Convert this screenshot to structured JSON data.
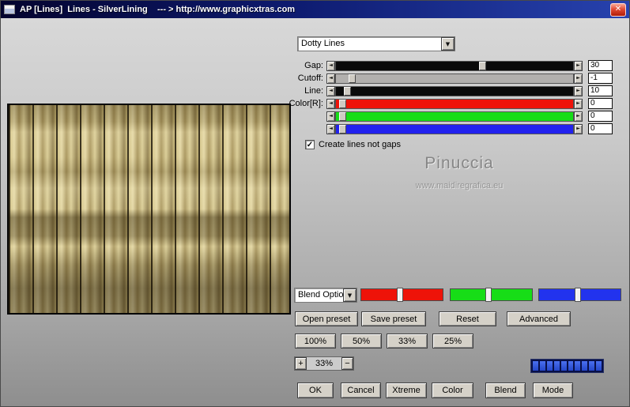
{
  "window": {
    "title": "AP [Lines]  Lines - SilverLining    --- > http://www.graphicxtras.com",
    "close_glyph": "✕"
  },
  "icons": {
    "left": "◄",
    "right": "►",
    "down": "▼",
    "check": "✓"
  },
  "preset": {
    "value": "Dotty Lines"
  },
  "sliders": [
    {
      "label": "Gap:",
      "value": "30",
      "track": "#0a0a0a",
      "thumb": 0.61
    },
    {
      "label": "Cutoff:",
      "value": "-1",
      "track": "#b2b0ae",
      "thumb": 0.06
    },
    {
      "label": "Line:",
      "value": "10",
      "track": "#0a0a0a",
      "thumb": 0.04
    },
    {
      "label": "Color[R]:",
      "value": "0",
      "track": "#ee1309",
      "thumb": 0.02
    },
    {
      "label": "",
      "value": "0",
      "track": "#17dd17",
      "thumb": 0.02
    },
    {
      "label": "",
      "value": "0",
      "track": "#2222ee",
      "thumb": 0.02
    }
  ],
  "checkbox": {
    "label": "Create lines not gaps",
    "checked": true
  },
  "watermark": {
    "name": "Pinuccia",
    "url": "www.maidiregrafica.eu"
  },
  "blend": {
    "dropdown": "Blend Optio",
    "ramps": [
      {
        "name": "red-channel-ramp",
        "color": "#ee1309",
        "thumb": 0.48
      },
      {
        "name": "green-channel-ramp",
        "color": "#17dd17",
        "thumb": 0.47
      },
      {
        "name": "blue-channel-ramp",
        "color": "#2233ee",
        "thumb": 0.48
      }
    ]
  },
  "preset_buttons": [
    "Open preset",
    "Save preset",
    "Reset",
    "Advanced"
  ],
  "zoom_buttons": [
    "100%",
    "50%",
    "33%",
    "25%"
  ],
  "zoom_stepper": {
    "plus": "+",
    "value": "33%",
    "minus": "−"
  },
  "progress": {
    "segments": 10,
    "filled": 10
  },
  "bottom_buttons": [
    "OK",
    "Cancel",
    "Xtreme",
    "Color",
    "Blend",
    "Mode"
  ]
}
